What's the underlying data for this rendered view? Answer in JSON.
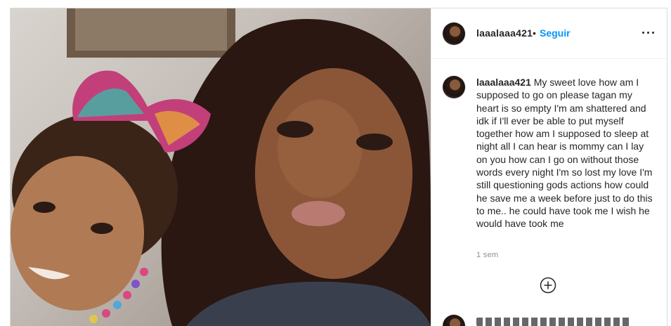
{
  "header": {
    "username": "laaalaaa421",
    "separator": "•",
    "follow_label": "Seguir",
    "avatar_icon": "profile-avatar-icon",
    "more_icon": "more-options-icon"
  },
  "caption": {
    "username": "laaalaaa421",
    "text": " My sweet love how am I supposed to go on please tagan my heart is so empty I'm am shattered and idk if I'll ever be able to put myself together how am I supposed to sleep at night all I can hear is mommy can I lay on you how can I go on without those words every night I'm so lost my love I'm still questioning gods actions how could he save me a week before just to do this to me.. he could have took me I wish he would have took me",
    "time": "1 sem"
  },
  "load_more_icon": "plus-circle-icon",
  "colors": {
    "link": "#0095f6",
    "text": "#262626",
    "muted": "#8e8e8e",
    "border": "#dbdbdb"
  }
}
